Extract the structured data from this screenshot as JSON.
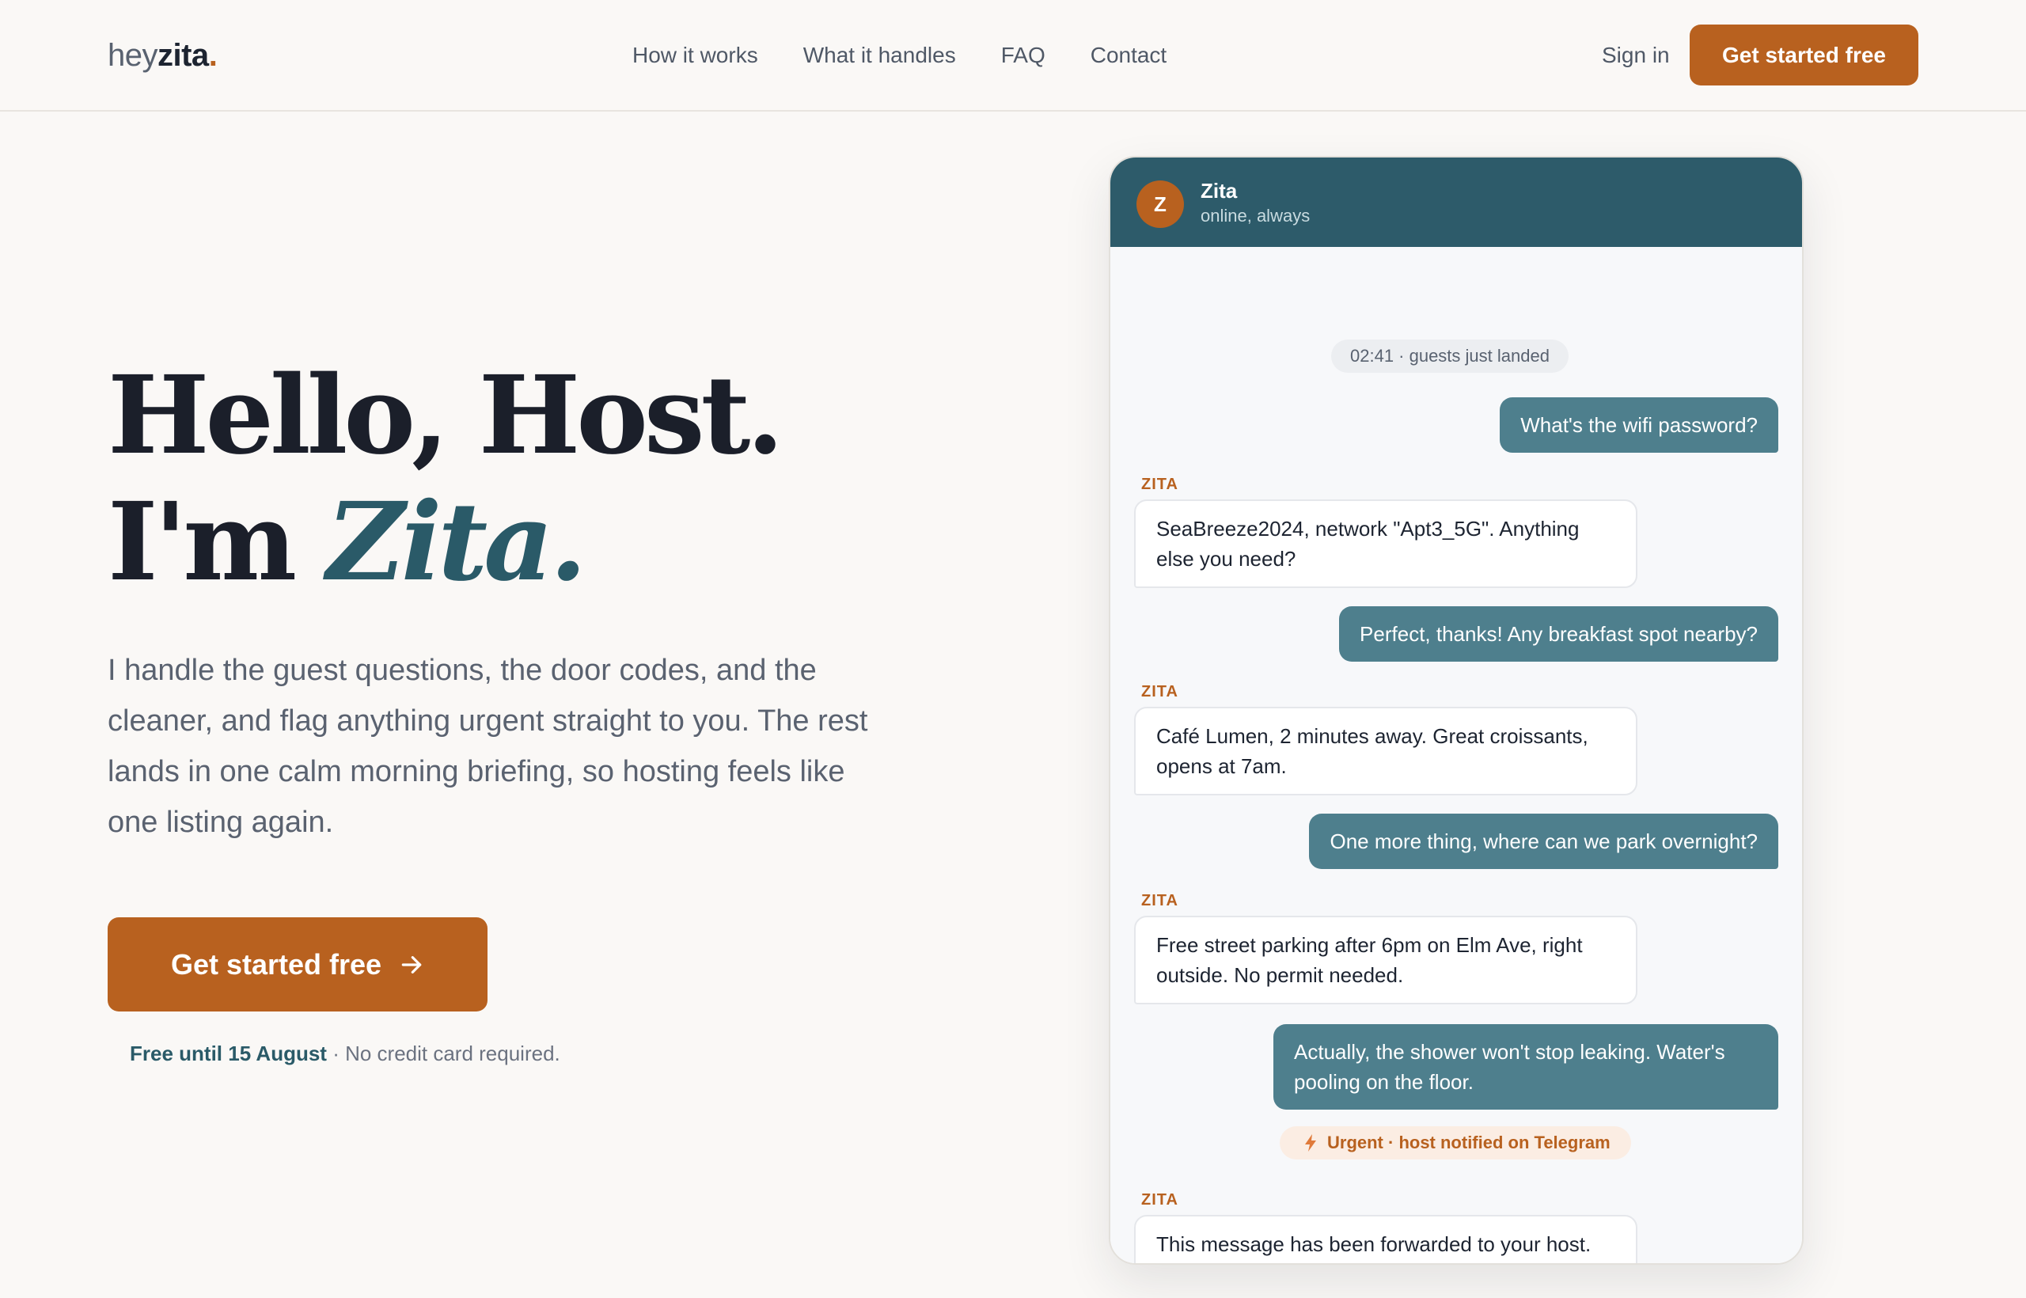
{
  "nav": {
    "logo_prefix": "hey",
    "logo_main": "zita",
    "logo_dot": ".",
    "links": [
      "How it works",
      "What it handles",
      "FAQ",
      "Contact"
    ],
    "signin": "Sign in",
    "cta": "Get started free"
  },
  "hero": {
    "title_line1": "Hello, Host.",
    "title_line2_prefix": "I'm ",
    "title_line2_name": "Zita.",
    "subtitle": "I handle the guest questions, the door codes, and the cleaner, and flag anything urgent straight to you. The rest lands in one calm morning briefing, so hosting feels like one listing again.",
    "cta": "Get started free",
    "fine_bold": "Free until 15 August",
    "fine_rest": " · No credit card required."
  },
  "chat": {
    "avatar_initial": "Z",
    "agent_name": "Zita",
    "agent_status": "online, always",
    "timestamp_pill": "02:41 · guests just landed",
    "sender_label": "ZITA",
    "messages": [
      {
        "from": "guest",
        "text": "What's the wifi password?"
      },
      {
        "from": "zita",
        "text": "SeaBreeze2024, network \"Apt3_5G\". Anything else you need?"
      },
      {
        "from": "guest",
        "text": "Perfect, thanks! Any breakfast spot nearby?"
      },
      {
        "from": "zita",
        "text": "Café Lumen, 2 minutes away. Great croissants, opens at 7am."
      },
      {
        "from": "guest",
        "text": "One more thing, where can we park overnight?"
      },
      {
        "from": "zita",
        "text": "Free street parking after 6pm on Elm Ave, right outside. No permit needed."
      },
      {
        "from": "guest",
        "text": "Actually, the shower won't stop leaking. Water's pooling on the floor."
      },
      {
        "from": "zita",
        "text": "This message has been forwarded to your host. They'll contact you directly."
      }
    ],
    "urgent_pill": "Urgent · host notified on Telegram"
  },
  "colors": {
    "accent": "#b8611f",
    "teal_dark": "#2d5b6a",
    "teal_bubble": "#4e7f8d",
    "background": "#faf8f6"
  }
}
